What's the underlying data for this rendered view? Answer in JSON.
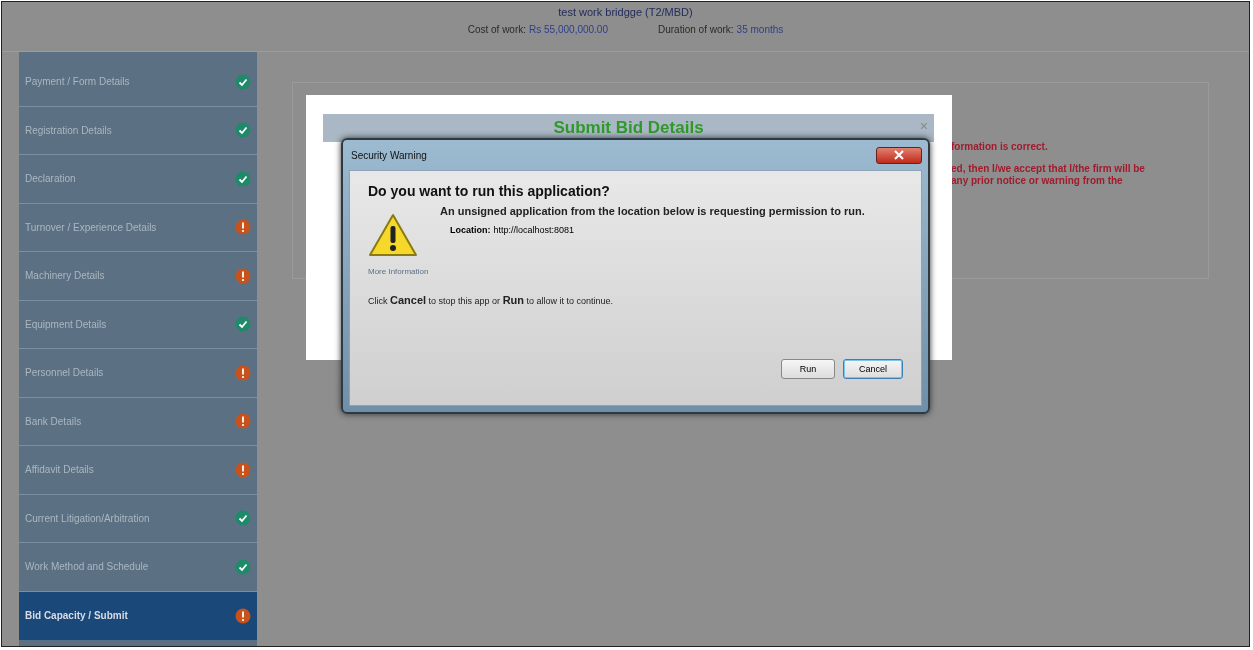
{
  "header": {
    "title": "test work bridgge (T2/MBD)",
    "cost_label": "Cost of work:",
    "cost_value": "Rs 55,000,000.00",
    "duration_label": "Duration of work:",
    "duration_value": "35 months"
  },
  "sidebar": {
    "items": [
      {
        "label": "Payment / Form Details",
        "complete": true,
        "selected": false
      },
      {
        "label": "Registration Details",
        "complete": true,
        "selected": false
      },
      {
        "label": "Declaration",
        "complete": true,
        "selected": false
      },
      {
        "label": "Turnover / Experience Details",
        "complete": false,
        "selected": false
      },
      {
        "label": "Machinery Details",
        "complete": false,
        "selected": false
      },
      {
        "label": "Equipment Details",
        "complete": true,
        "selected": false
      },
      {
        "label": "Personnel Details",
        "complete": false,
        "selected": false
      },
      {
        "label": "Bank Details",
        "complete": false,
        "selected": false
      },
      {
        "label": "Affidavit Details",
        "complete": false,
        "selected": false
      },
      {
        "label": "Current Litigation/Arbitration",
        "complete": true,
        "selected": false
      },
      {
        "label": "Work Method and Schedule",
        "complete": true,
        "selected": false
      },
      {
        "label": "Bid Capacity / Submit",
        "complete": false,
        "selected": true
      }
    ]
  },
  "panel": {
    "notes": [
      "formation is correct.",
      "ed, then I/we accept that I/the firm will be",
      "any prior notice or warning from the"
    ]
  },
  "modal": {
    "title": "Submit Bid Details",
    "close": "×"
  },
  "security_dialog": {
    "title": "Security Warning",
    "heading": "Do you want to run this application?",
    "message": "An unsigned application from the location below is requesting permission to run.",
    "location_label": "Location:",
    "location_value": "http://localhost:8081",
    "more_info": "More Information",
    "instruction": "Click **Cancel** to stop this app or **Run** to allow it to continue.",
    "buttons": [
      {
        "label": "Run",
        "focused": false
      },
      {
        "label": "Cancel",
        "focused": true
      }
    ]
  }
}
